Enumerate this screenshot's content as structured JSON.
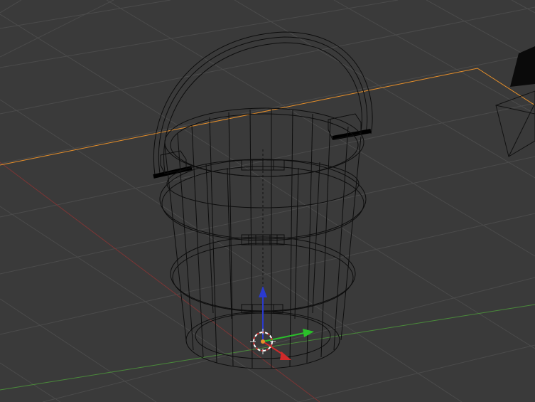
{
  "viewport": {
    "mode": "wireframe",
    "background": "#3a3a3a",
    "grid_color": "#4d4d4d",
    "x_axis_color": "#8a3a3a",
    "y_axis_color": "#4e8a3a",
    "selection_outline_color": "#e8902a",
    "wire_color": "#0d0d0d"
  },
  "scene_objects": [
    {
      "name": "bucket",
      "type": "mesh",
      "selected": false
    },
    {
      "name": "camera",
      "type": "camera",
      "selected": false
    }
  ],
  "gizmo": {
    "x_axis_color": "#d02a2a",
    "y_axis_color": "#2ac02a",
    "z_axis_color": "#2a3ad0",
    "cursor_icon": "3d-cursor-icon"
  }
}
